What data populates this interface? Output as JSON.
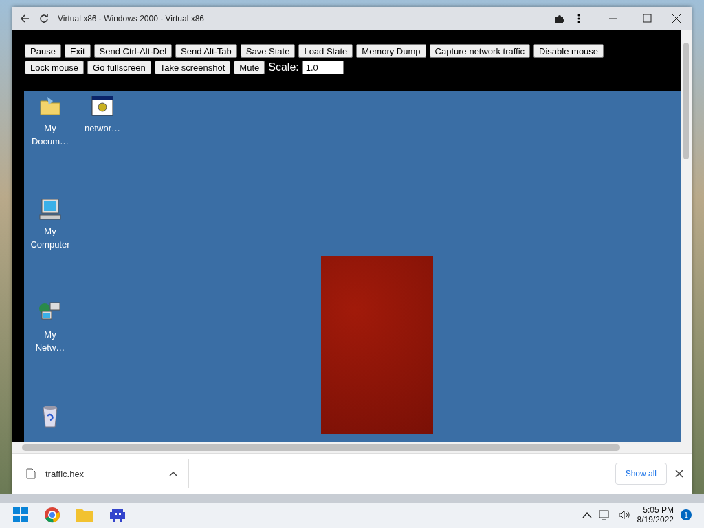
{
  "window": {
    "title": "Virtual x86 - Windows 2000 - Virtual x86"
  },
  "toolbar": {
    "buttons": [
      "Pause",
      "Exit",
      "Send Ctrl-Alt-Del",
      "Send Alt-Tab",
      "Save State",
      "Load State",
      "Memory Dump",
      "Capture network traffic",
      "Disable mouse",
      "Lock mouse",
      "Go fullscreen",
      "Take screenshot",
      "Mute"
    ],
    "scale": {
      "label": "Scale:",
      "value": "1.0"
    }
  },
  "desktop": {
    "icons": [
      {
        "kind": "folder",
        "label": "My Docum…"
      },
      {
        "kind": "program",
        "label": "networ…"
      },
      {
        "kind": "computer",
        "label": "My Computer"
      },
      {
        "kind": "network",
        "label": "My Netw…"
      },
      {
        "kind": "recycle"
      }
    ]
  },
  "download_bar": {
    "file": "traffic.hex",
    "show_all": "Show all"
  },
  "taskbar": {
    "time": "5:05 PM",
    "date": "8/19/2022",
    "notifications": "1"
  }
}
